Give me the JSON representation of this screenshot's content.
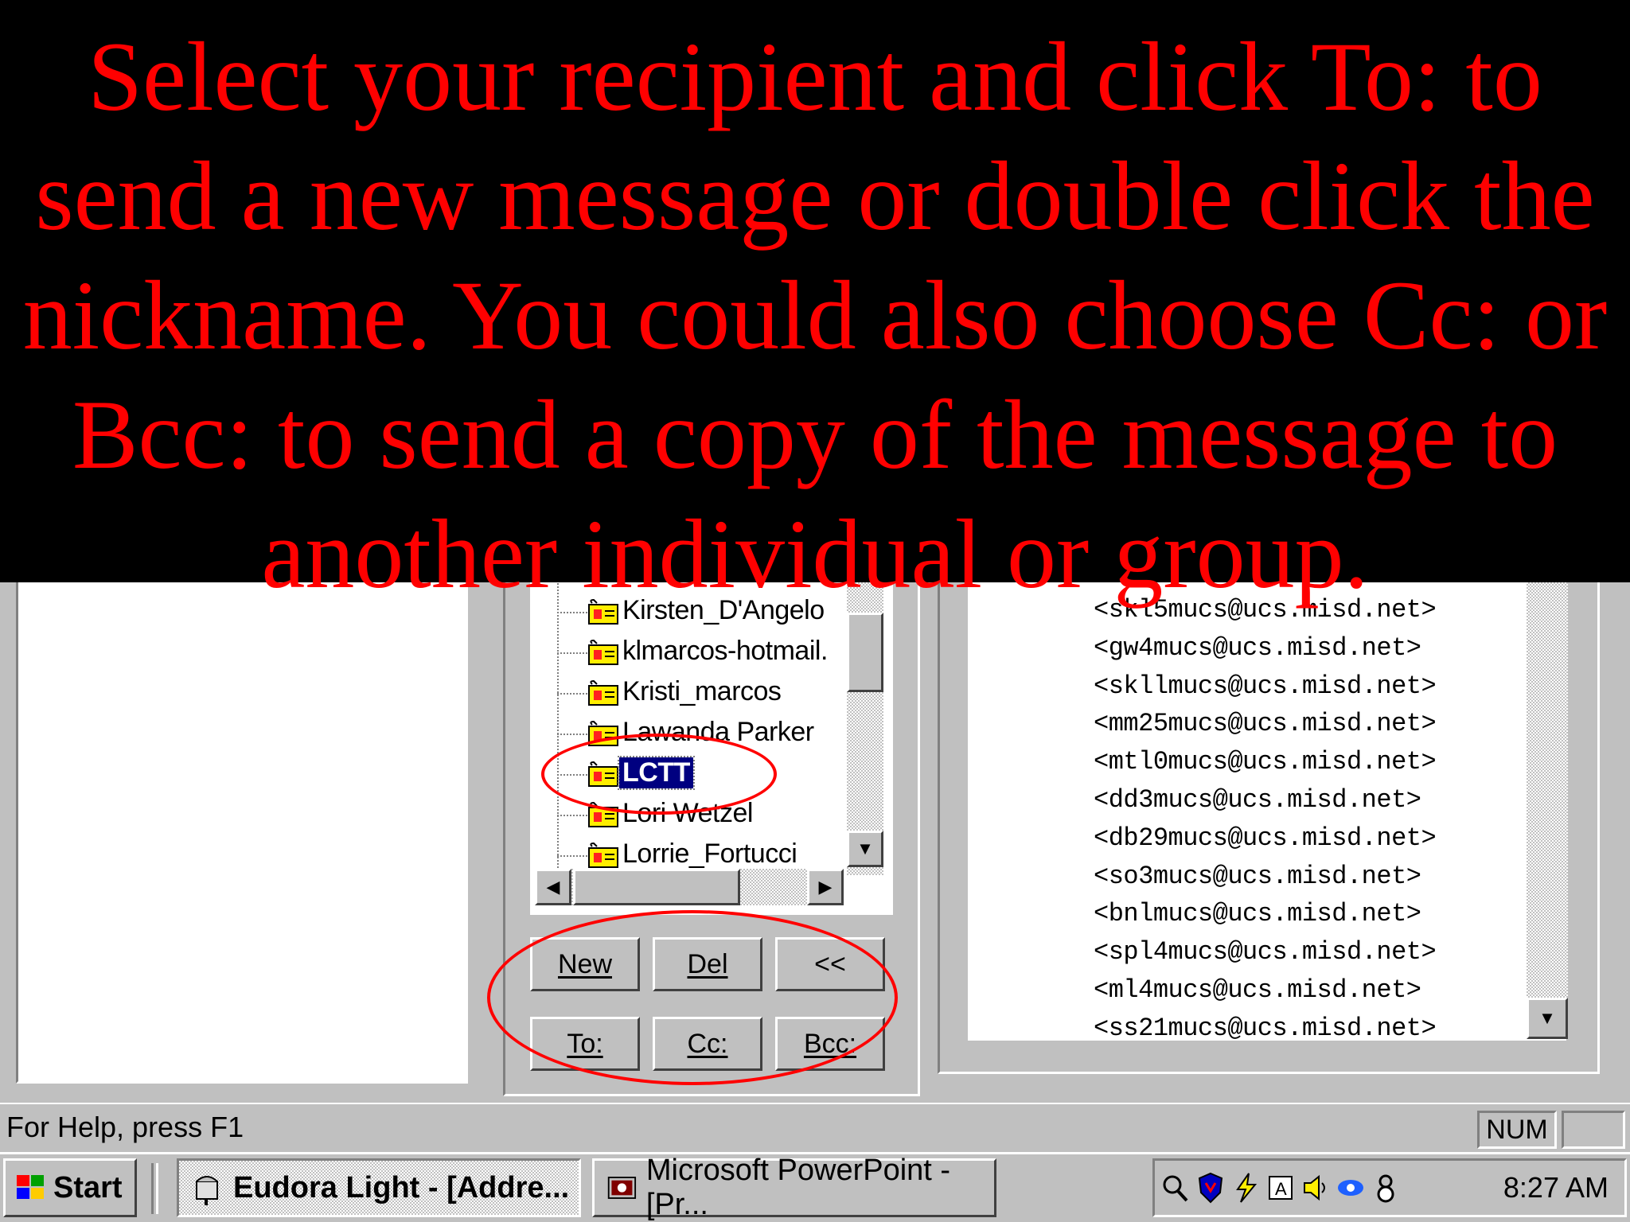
{
  "caption": "Select your recipient and click To: to send a new message or double click the nickname. You could also choose Cc: or Bcc: to send a copy of the message to another individual or group.",
  "nicknames": [
    {
      "label": "Kirsten_D'Angelo",
      "selected": false
    },
    {
      "label": "klmarcos-hotmail.",
      "selected": false
    },
    {
      "label": "Kristi_marcos",
      "selected": false
    },
    {
      "label": "Lawanda Parker",
      "selected": false
    },
    {
      "label": "LCTT",
      "selected": true
    },
    {
      "label": "Lori Wetzel",
      "selected": false
    },
    {
      "label": "Lorrie_Fortucci",
      "selected": false
    }
  ],
  "buttons": {
    "new": "New",
    "del": "Del",
    "back": "<<",
    "to": "To:",
    "cc": "Cc:",
    "bcc": "Bcc:"
  },
  "addresses": [
    "<skl5mucs@ucs.misd.net>",
    "<gw4mucs@ucs.misd.net>",
    "<skllmucs@ucs.misd.net>",
    "<mm25mucs@ucs.misd.net>",
    "<mtl0mucs@ucs.misd.net>",
    "<dd3mucs@ucs.misd.net>",
    "<db29mucs@ucs.misd.net>",
    "<so3mucs@ucs.misd.net>",
    "<bnlmucs@ucs.misd.net>",
    "<spl4mucs@ucs.misd.net>",
    "<ml4mucs@ucs.misd.net>",
    "<ss21mucs@ucs.misd.net>"
  ],
  "status": {
    "help": "For Help, press F1",
    "num": "NUM"
  },
  "taskbar": {
    "start": "Start",
    "eudora": "Eudora Light - [Addre...",
    "powerpoint": "Microsoft PowerPoint - [Pr...",
    "clock": "8:27 AM"
  },
  "colors": {
    "caption_text": "#ff0000",
    "caption_bg": "#000000",
    "selection": "#000080",
    "ellipse": "#ff0000"
  }
}
